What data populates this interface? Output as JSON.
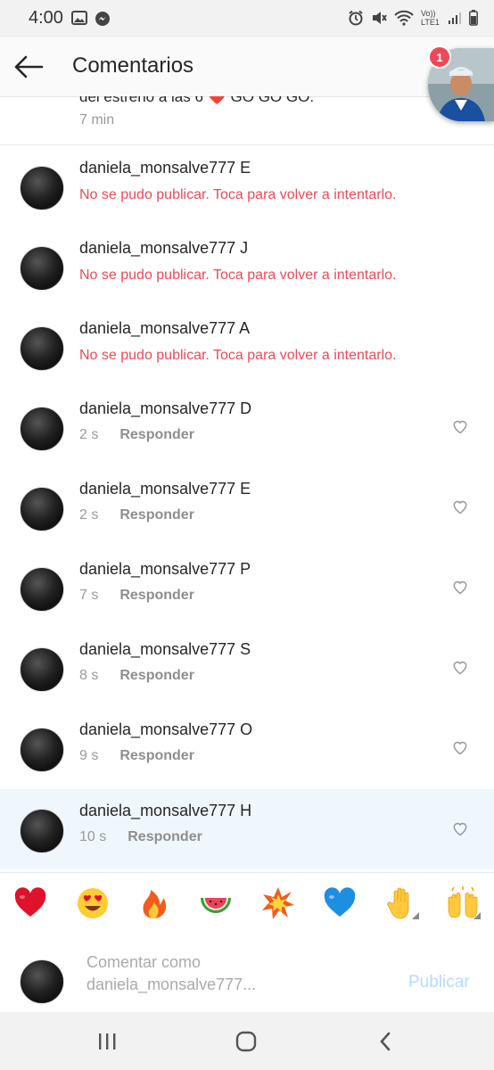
{
  "status_bar": {
    "time": "4:00",
    "network_label": "Vo)) LTE1"
  },
  "header": {
    "title": "Comentarios",
    "badge_count": "1"
  },
  "previous_comment": {
    "text": "del estreno a las 6 ❤️ GO GO GO.",
    "time": "7 min"
  },
  "comments": [
    {
      "username": "daniela_monsalve777",
      "text": "E",
      "status": "error",
      "error": "No se pudo publicar. Toca para volver a intentarlo."
    },
    {
      "username": "daniela_monsalve777",
      "text": "J",
      "status": "error",
      "error": "No se pudo publicar. Toca para volver a intentarlo."
    },
    {
      "username": "daniela_monsalve777",
      "text": "A",
      "status": "error",
      "error": "No se pudo publicar. Toca para volver a intentarlo."
    },
    {
      "username": "daniela_monsalve777",
      "text": "D",
      "status": "posted",
      "time": "2 s",
      "reply": "Responder"
    },
    {
      "username": "daniela_monsalve777",
      "text": "E",
      "status": "posted",
      "time": "2 s",
      "reply": "Responder"
    },
    {
      "username": "daniela_monsalve777",
      "text": "P",
      "status": "posted",
      "time": "7 s",
      "reply": "Responder"
    },
    {
      "username": "daniela_monsalve777",
      "text": "S",
      "status": "posted",
      "time": "8 s",
      "reply": "Responder"
    },
    {
      "username": "daniela_monsalve777",
      "text": "O",
      "status": "posted",
      "time": "9 s",
      "reply": "Responder"
    },
    {
      "username": "daniela_monsalve777",
      "text": "H",
      "status": "posted",
      "time": "10 s",
      "reply": "Responder"
    }
  ],
  "emoji_bar": [
    "❤️",
    "😍",
    "🔥",
    "🍉",
    "💥",
    "💙",
    "✋",
    "🙌"
  ],
  "input": {
    "placeholder_line1": "Comentar como",
    "placeholder_line2": "daniela_monsalve777...",
    "publish_label": "Publicar"
  },
  "colors": {
    "error": "#ed4956",
    "publish_disabled": "#b3dbff",
    "highlight": "#eff6fc"
  }
}
